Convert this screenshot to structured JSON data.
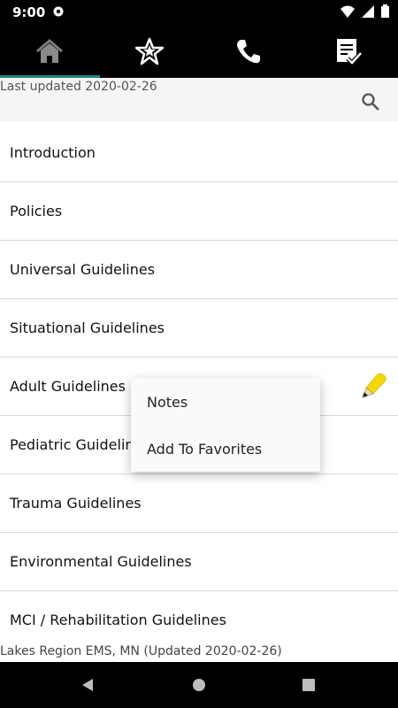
{
  "status_bar": {
    "time": "9:00"
  },
  "header": {
    "last_updated": "Last updated 2020-02-26"
  },
  "list": {
    "items": [
      {
        "label": "Introduction"
      },
      {
        "label": "Policies"
      },
      {
        "label": "Universal Guidelines"
      },
      {
        "label": "Situational Guidelines"
      },
      {
        "label": "Adult Guidelines"
      },
      {
        "label": "Pediatric Guidelines"
      },
      {
        "label": "Trauma Guidelines"
      },
      {
        "label": "Environmental Guidelines"
      },
      {
        "label": "MCI / Rehabilitation Guidelines"
      }
    ]
  },
  "context_menu": {
    "items": [
      {
        "label": "Notes"
      },
      {
        "label": "Add To Favorites"
      }
    ]
  },
  "footer": {
    "text": "Lakes Region EMS, MN (Updated 2020-02-26)"
  },
  "colors": {
    "tab_indicator": "#1a8a7e",
    "pencil": "#f6d800"
  },
  "icons": [
    "gear-icon",
    "wifi-icon",
    "signal-icon",
    "battery-icon",
    "home-icon",
    "star-icon",
    "phone-icon",
    "checklist-icon",
    "search-icon",
    "pencil-icon",
    "back-icon",
    "home-nav-icon",
    "recents-icon"
  ]
}
